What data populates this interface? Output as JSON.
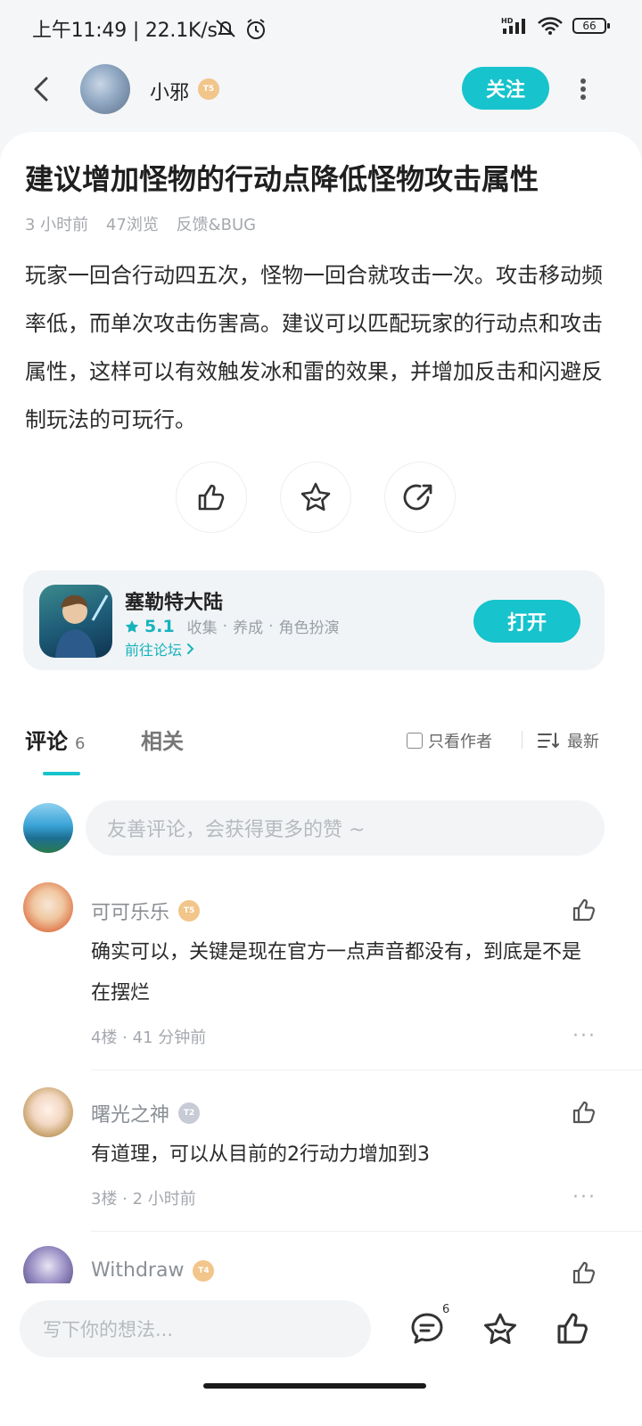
{
  "status_bar": {
    "time": "上午11:49",
    "speed": "22.1K/s",
    "battery": "66",
    "network": "HD"
  },
  "header": {
    "user_name": "小邪",
    "user_badge": "T5",
    "follow_label": "关注"
  },
  "post": {
    "title": "建议增加怪物的行动点降低怪物攻击属性",
    "time": "3 小时前",
    "views": "47浏览",
    "category": "反馈&BUG",
    "content": "玩家一回合行动四五次，怪物一回合就攻击一次。攻击移动频率低，而单次攻击伤害高。建议可以匹配玩家的行动点和攻击属性，这样可以有效触发冰和雷的效果，并增加反击和闪避反制玩法的可玩行。"
  },
  "game": {
    "name": "塞勒特大陆",
    "rating": "5.1",
    "tags": [
      "收集",
      "养成",
      "角色扮演"
    ],
    "forum_link": "前往论坛",
    "open_label": "打开"
  },
  "comments_section": {
    "tab_comments": "评论",
    "comment_count": "6",
    "tab_related": "相关",
    "only_author": "只看作者",
    "sort_label": "最新",
    "input_placeholder": "友善评论，会获得更多的赞 ~"
  },
  "comments": [
    {
      "name": "可可乐乐",
      "badge": "T5",
      "text": "确实可以，关键是现在官方一点声音都没有，到底是不是在摆烂",
      "floor": "4楼",
      "time": "41 分钟前"
    },
    {
      "name": "曙光之神",
      "badge": "T2",
      "text": "有道理，可以从目前的2行动力增加到3",
      "floor": "3楼",
      "time": "2 小时前"
    },
    {
      "name": "Withdraw",
      "badge": "T4"
    }
  ],
  "bottom_bar": {
    "input_placeholder": "写下你的想法...",
    "comment_count": "6"
  },
  "colors": {
    "accent": "#17c3cc",
    "badge_gold": "#f2c58a",
    "badge_silver": "#c7cbd6"
  }
}
